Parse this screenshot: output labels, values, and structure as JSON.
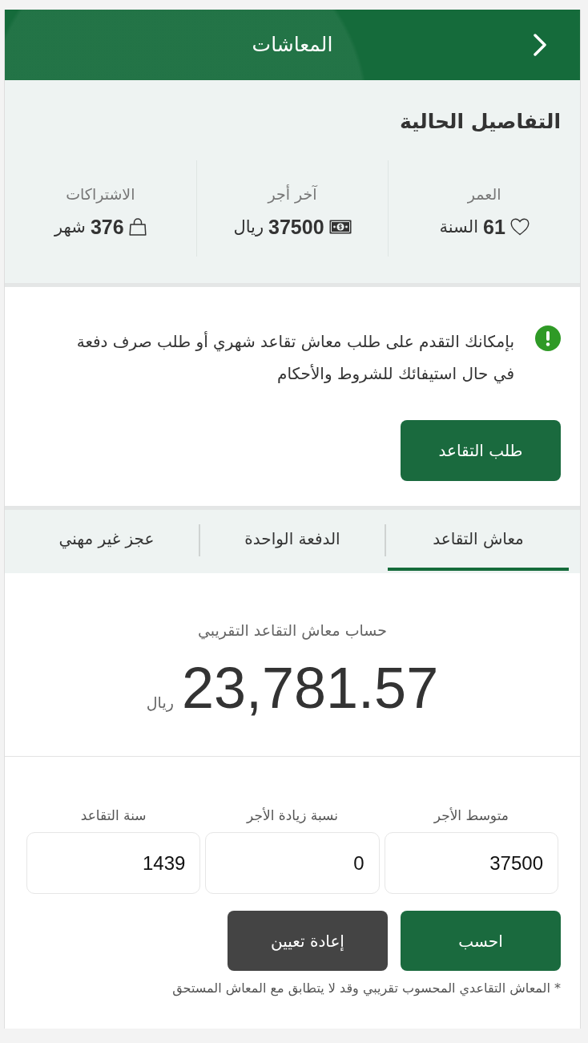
{
  "header": {
    "title": "المعاشات"
  },
  "details": {
    "title": "التفاصيل الحالية",
    "stats": [
      {
        "kind": "age",
        "label": "العمر",
        "value": "61",
        "unit": "السنة"
      },
      {
        "kind": "wage",
        "label": "آخر أجر",
        "value": "37500",
        "unit": "ريال"
      },
      {
        "kind": "subscriptions",
        "label": "الاشتراكات",
        "value": "376",
        "unit": "شهر"
      }
    ]
  },
  "notice": {
    "text": "بإمكانك التقدم على طلب معاش تقاعد شهري أو طلب صرف دفعة في حال استيفائك للشروط والأحكام",
    "button": "طلب التقاعد"
  },
  "tabs": [
    {
      "label": "معاش التقاعد",
      "selected": true
    },
    {
      "label": "الدفعة الواحدة",
      "selected": false
    },
    {
      "label": "عجز غير مهني",
      "selected": false
    }
  ],
  "result": {
    "label": "حساب معاش التقاعد التقريبي",
    "amount": "23,781.57",
    "currency": "ريال"
  },
  "calculator": {
    "fields": [
      {
        "label": "متوسط الأجر",
        "value": "37500"
      },
      {
        "label": "نسبة زيادة الأجر",
        "value": "0"
      },
      {
        "label": "سنة التقاعد",
        "value": "1439"
      }
    ],
    "buttons": [
      {
        "kind": "primary",
        "label": "احسب"
      },
      {
        "kind": "secondary",
        "label": "إعادة تعيين"
      }
    ],
    "footnote": "* المعاش التقاعدي المحسوب تقريبي وقد لا يتطابق مع المعاش المستحق"
  }
}
